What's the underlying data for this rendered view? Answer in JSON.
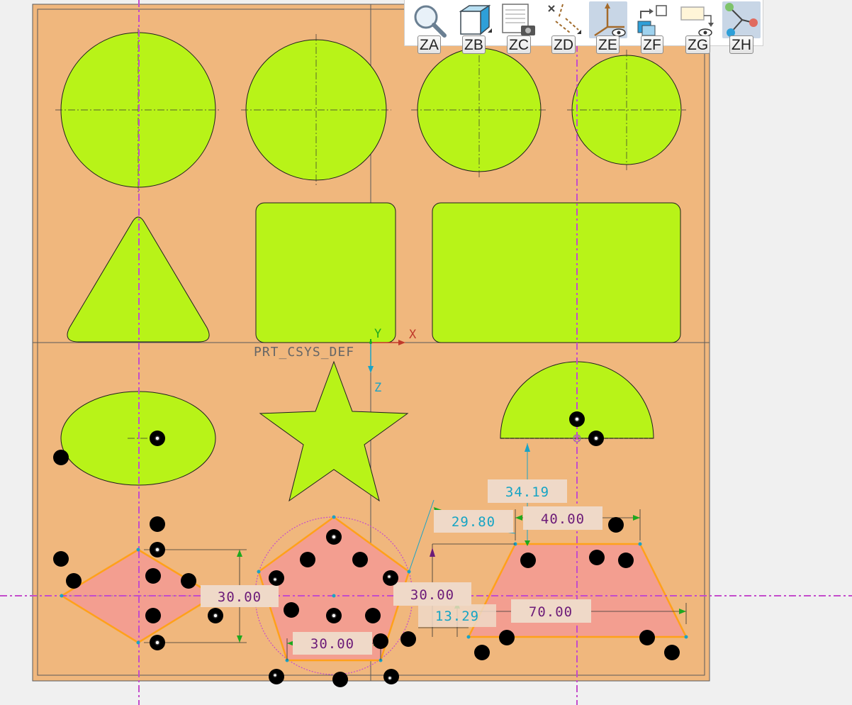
{
  "coordinate_system": {
    "name": "PRT_CSYS_DEF",
    "x_label": "X",
    "y_label": "Y",
    "z_label": "Z"
  },
  "dimensions": [
    {
      "id": "trap_height",
      "value": "34.19",
      "kind": "reference"
    },
    {
      "id": "trap_angle",
      "value": "29.80",
      "kind": "reference"
    },
    {
      "id": "trap_top",
      "value": "40.00",
      "kind": "strong"
    },
    {
      "id": "trap_bottom",
      "value": "70.00",
      "kind": "strong"
    },
    {
      "id": "diamond_height",
      "value": "30.00",
      "kind": "strong"
    },
    {
      "id": "pentagon_side",
      "value": "30.00",
      "kind": "strong"
    },
    {
      "id": "pentagon_offset",
      "value": "30.00",
      "kind": "strong"
    },
    {
      "id": "trap_offset",
      "value": "13.29",
      "kind": "reference"
    }
  ],
  "toolbar": {
    "buttons": [
      {
        "key": "ZA",
        "name": "zoom",
        "icon": "magnifier-icon"
      },
      {
        "key": "ZB",
        "name": "saved-orientations",
        "icon": "view-cube-icon"
      },
      {
        "key": "ZC",
        "name": "sketch-display-filters",
        "icon": "sheet-camera-icon"
      },
      {
        "key": "ZD",
        "name": "datum-display",
        "icon": "datum-axes-icon"
      },
      {
        "key": "ZE",
        "name": "csys-display",
        "icon": "csys-eye-icon"
      },
      {
        "key": "ZF",
        "name": "display-style",
        "icon": "layers-arrow-icon"
      },
      {
        "key": "ZG",
        "name": "annotation-display",
        "icon": "note-eye-icon"
      },
      {
        "key": "ZH",
        "name": "sketcher-display",
        "icon": "nodes-icon",
        "active": true
      }
    ]
  },
  "colors": {
    "background": "#f0b77d",
    "shape_fill": "#b8f318",
    "active_fill": "#f39e90",
    "active_edge": "#ffa11a",
    "centerline": "#c44ccb",
    "dimension_strong": "#6c1b78",
    "dimension_weak": "#16a4c4",
    "constraint_arrow": "#1ea81e"
  }
}
